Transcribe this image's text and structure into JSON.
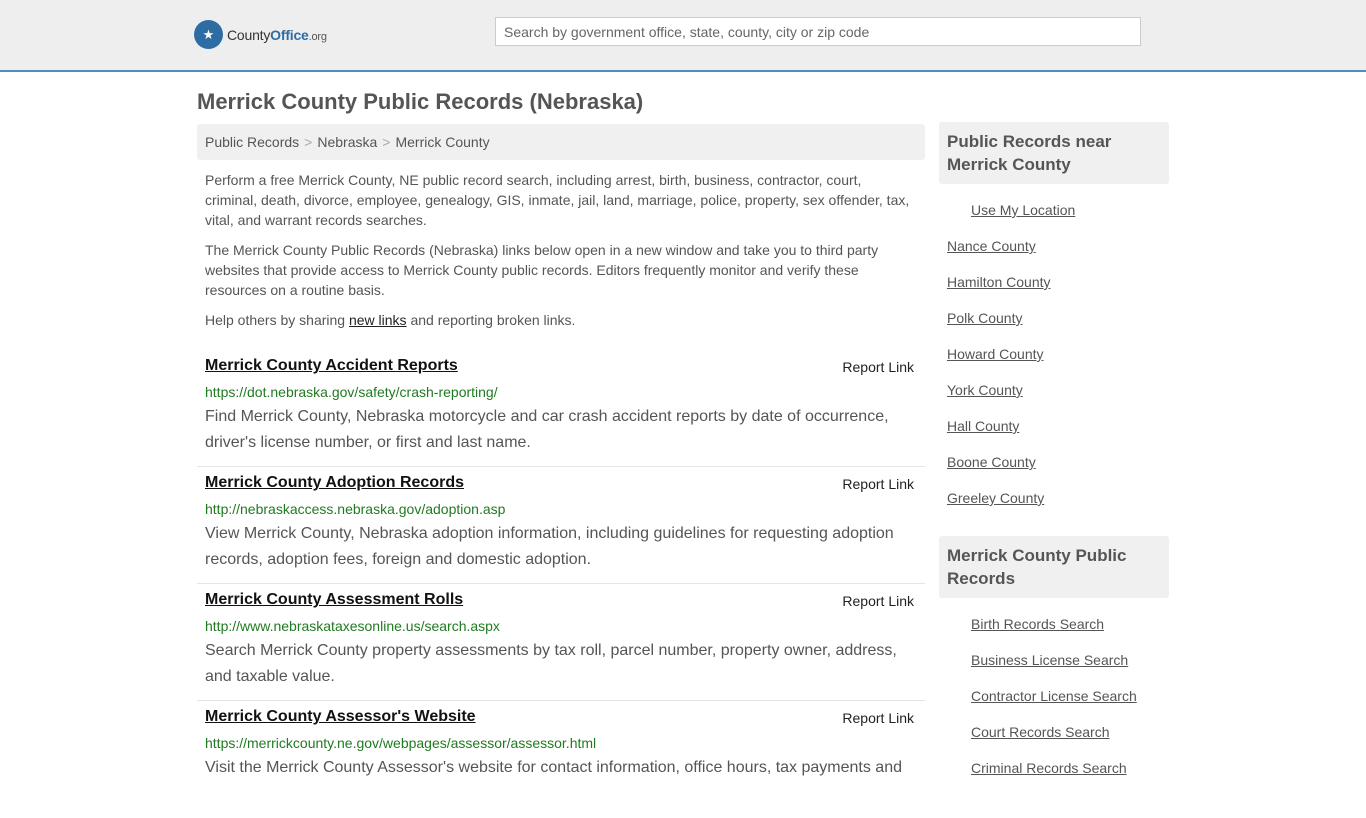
{
  "header": {
    "logo_text_a": "County",
    "logo_text_b": "Office",
    "logo_text_c": ".org",
    "search_placeholder": "Search by government office, state, county, city or zip code"
  },
  "page_title": "Merrick County Public Records (Nebraska)",
  "breadcrumb": [
    "Public Records",
    "Nebraska",
    "Merrick County"
  ],
  "intro": {
    "p1": "Perform a free Merrick County, NE public record search, including arrest, birth, business, contractor, court, criminal, death, divorce, employee, genealogy, GIS, inmate, jail, land, marriage, police, property, sex offender, tax, vital, and warrant records searches.",
    "p2": "The Merrick County Public Records (Nebraska) links below open in a new window and take you to third party websites that provide access to Merrick County public records. Editors frequently monitor and verify these resources on a routine basis.",
    "p3_before": "Help others by sharing ",
    "p3_link": "new links",
    "p3_after": " and reporting broken links."
  },
  "records": [
    {
      "title": "Merrick County Accident Reports",
      "report": "Report Link",
      "url": "https://dot.nebraska.gov/safety/crash-reporting/",
      "desc": "Find Merrick County, Nebraska motorcycle and car crash accident reports by date of occurrence, driver's license number, or first and last name."
    },
    {
      "title": "Merrick County Adoption Records",
      "report": "Report Link",
      "url": "http://nebraskaccess.nebraska.gov/adoption.asp",
      "desc": "View Merrick County, Nebraska adoption information, including guidelines for requesting adoption records, adoption fees, foreign and domestic adoption."
    },
    {
      "title": "Merrick County Assessment Rolls",
      "report": "Report Link",
      "url": "http://www.nebraskataxesonline.us/search.aspx",
      "desc": "Search Merrick County property assessments by tax roll, parcel number, property owner, address, and taxable value."
    },
    {
      "title": "Merrick County Assessor's Website",
      "report": "Report Link",
      "url": "https://merrickcounty.ne.gov/webpages/assessor/assessor.html",
      "desc": "Visit the Merrick County Assessor's website for contact information, office hours, tax payments and"
    }
  ],
  "sidebar": {
    "near_title": "Public Records near Merrick County",
    "use_location": "Use My Location",
    "near_counties": [
      "Nance County",
      "Hamilton County",
      "Polk County",
      "Howard County",
      "York County",
      "Hall County",
      "Boone County",
      "Greeley County"
    ],
    "records_title": "Merrick County Public Records",
    "record_links": [
      "Birth Records Search",
      "Business License Search",
      "Contractor License Search",
      "Court Records Search",
      "Criminal Records Search"
    ]
  }
}
